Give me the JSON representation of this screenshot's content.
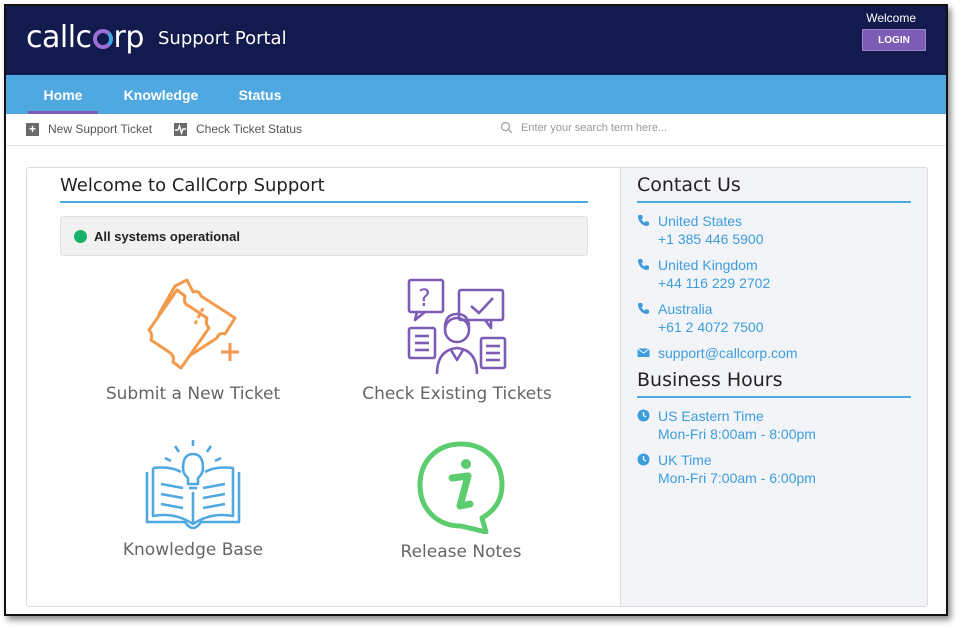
{
  "header": {
    "logo_left": "callc",
    "logo_right": "rp",
    "portal_title": "Support Portal",
    "welcome": "Welcome",
    "login_label": "LOGIN"
  },
  "nav": {
    "tabs": [
      {
        "label": "Home",
        "active": true
      },
      {
        "label": "Knowledge",
        "active": false
      },
      {
        "label": "Status",
        "active": false
      }
    ]
  },
  "toolbar": {
    "new_ticket": "New Support Ticket",
    "check_status": "Check Ticket Status",
    "search_placeholder": "Enter your search term here..."
  },
  "main": {
    "title": "Welcome to CallCorp Support",
    "status_text": "All systems operational",
    "tiles": [
      {
        "label": "Submit a New Ticket",
        "icon": "ticket-plus-icon",
        "color": "#f39a4d"
      },
      {
        "label": "Check Existing Tickets",
        "icon": "support-agent-icon",
        "color": "#7c5cb5"
      },
      {
        "label": "Knowledge Base",
        "icon": "book-lightbulb-icon",
        "color": "#4fa8df"
      },
      {
        "label": "Release Notes",
        "icon": "info-bubble-icon",
        "color": "#5ccd6e"
      }
    ]
  },
  "contact": {
    "title": "Contact Us",
    "entries": [
      {
        "icon": "phone-icon",
        "line1": "United States",
        "line2": "+1 385 446 5900"
      },
      {
        "icon": "phone-icon",
        "line1": "United Kingdom",
        "line2": "+44 116 229 2702"
      },
      {
        "icon": "phone-icon",
        "line1": "Australia",
        "line2": "+61 2 4072 7500"
      },
      {
        "icon": "envelope-icon",
        "line1": "support@callcorp.com"
      }
    ]
  },
  "hours": {
    "title": "Business Hours",
    "entries": [
      {
        "icon": "clock-icon",
        "line1": "US Eastern Time",
        "line2": "Mon-Fri 8:00am - 8:00pm"
      },
      {
        "icon": "clock-icon",
        "line1": "UK Time",
        "line2": "Mon-Fri 7:00am - 6:00pm"
      }
    ]
  },
  "colors": {
    "header_bg": "#131a4d",
    "nav_bg": "#4fa8df",
    "accent": "#7c5cb5",
    "link": "#3d9ddd",
    "status_ok": "#17b26a"
  }
}
